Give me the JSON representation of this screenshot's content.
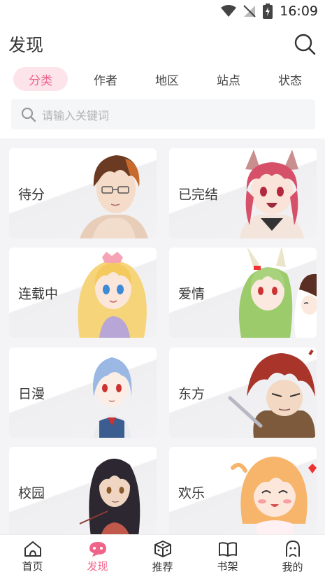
{
  "status_bar": {
    "time": "16:09"
  },
  "header": {
    "title": "发现"
  },
  "tabs": [
    {
      "label": "分类",
      "active": true
    },
    {
      "label": "作者",
      "active": false
    },
    {
      "label": "地区",
      "active": false
    },
    {
      "label": "站点",
      "active": false
    },
    {
      "label": "状态",
      "active": false
    }
  ],
  "search": {
    "placeholder": "请输入关键词"
  },
  "categories": [
    {
      "label": "待分",
      "art": "brown-hair-glasses-boy"
    },
    {
      "label": "已完结",
      "art": "pink-hair-cat-ears-girl"
    },
    {
      "label": "连载中",
      "art": "blonde-princess-girl"
    },
    {
      "label": "爱情",
      "art": "green-hair-bunny-girl"
    },
    {
      "label": "日漫",
      "art": "blue-hair-girl"
    },
    {
      "label": "东方",
      "art": "red-hair-swordsman"
    },
    {
      "label": "校园",
      "art": "dark-hair-girl"
    },
    {
      "label": "欢乐",
      "art": "orange-hair-chibi-girl"
    }
  ],
  "bottom_nav": [
    {
      "label": "首页",
      "icon": "home-icon",
      "active": false
    },
    {
      "label": "发现",
      "icon": "discover-icon",
      "active": true
    },
    {
      "label": "推荐",
      "icon": "dice-icon",
      "active": false
    },
    {
      "label": "书架",
      "icon": "book-icon",
      "active": false
    },
    {
      "label": "我的",
      "icon": "user-icon",
      "active": false
    }
  ],
  "colors": {
    "accent": "#f06489",
    "accent_bg": "#fde3ea"
  }
}
